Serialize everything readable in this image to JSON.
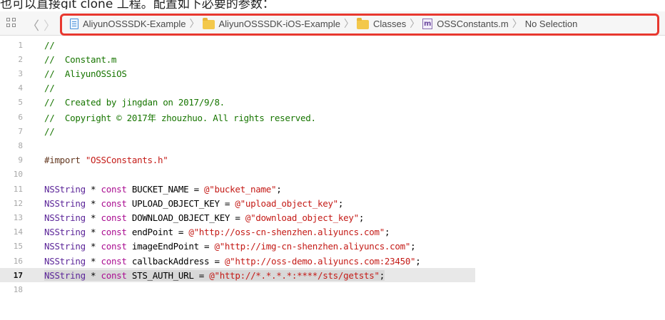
{
  "caption": "也可以直接git clone 工程。配置如下必要的参数：",
  "jumpbar": {
    "nav_back": "〈",
    "nav_forward": "〉",
    "crumbs": [
      {
        "label": "AliyunOSSSDK-Example",
        "icon": "project-file-icon"
      },
      {
        "label": "AliyunOSSSDK-iOS-Example",
        "icon": "folder-icon"
      },
      {
        "label": "Classes",
        "icon": "folder-icon"
      },
      {
        "label": "OSSConstants.m",
        "icon": "objc-m-file-icon",
        "icon_glyph": "m"
      },
      {
        "label": "No Selection",
        "icon": ""
      }
    ],
    "separator": "〉",
    "highlight_color": "#e8382f"
  },
  "editor": {
    "current_line": 17,
    "lines": [
      {
        "n": "1",
        "text": "//"
      },
      {
        "n": "2",
        "text": "//  Constant.m"
      },
      {
        "n": "3",
        "text": "//  AliyunOSSiOS"
      },
      {
        "n": "4",
        "text": "//"
      },
      {
        "n": "5",
        "text": "//  Created by jingdan on 2017/9/8."
      },
      {
        "n": "6",
        "text": "//  Copyright © 2017年 zhouzhuo. All rights reserved."
      },
      {
        "n": "7",
        "text": "//"
      },
      {
        "n": "8",
        "text": ""
      },
      {
        "n": "9",
        "pp": "#import ",
        "str": "\"OSSConstants.h\""
      },
      {
        "n": "10",
        "text": ""
      },
      {
        "n": "11",
        "type": "NSString",
        "op": " * ",
        "kw": "const",
        "name": " BUCKET_NAME = ",
        "str": "@\"bucket_name\"",
        "end": ";"
      },
      {
        "n": "12",
        "type": "NSString",
        "op": " * ",
        "kw": "const",
        "name": " UPLOAD_OBJECT_KEY = ",
        "str": "@\"upload_object_key\"",
        "end": ";"
      },
      {
        "n": "13",
        "type": "NSString",
        "op": " * ",
        "kw": "const",
        "name": " DOWNLOAD_OBJECT_KEY = ",
        "str": "@\"download_object_key\"",
        "end": ";"
      },
      {
        "n": "14",
        "type": "NSString",
        "op": " * ",
        "kw": "const",
        "name": " endPoint = ",
        "str": "@\"http://oss-cn-shenzhen.aliyuncs.com\"",
        "end": ";"
      },
      {
        "n": "15",
        "type": "NSString",
        "op": " * ",
        "kw": "const",
        "name": " imageEndPoint = ",
        "str": "@\"http://img-cn-shenzhen.aliyuncs.com\"",
        "end": ";"
      },
      {
        "n": "16",
        "type": "NSString",
        "op": " * ",
        "kw": "const",
        "name": " callbackAddress = ",
        "str": "@\"http://oss-demo.aliyuncs.com:23450\"",
        "end": ";"
      },
      {
        "n": "17",
        "type": "NSString",
        "op": " * ",
        "kw": "const",
        "name": " STS_AUTH_URL = ",
        "str": "@\"http://*.*.*.*:****/sts/getsts\"",
        "end": ";"
      },
      {
        "n": "18",
        "text": ""
      }
    ]
  },
  "colors": {
    "comment": "#177500",
    "string": "#c41a16",
    "type": "#5c2699",
    "keyword": "#aa0d91",
    "preprocessor": "#633820"
  }
}
